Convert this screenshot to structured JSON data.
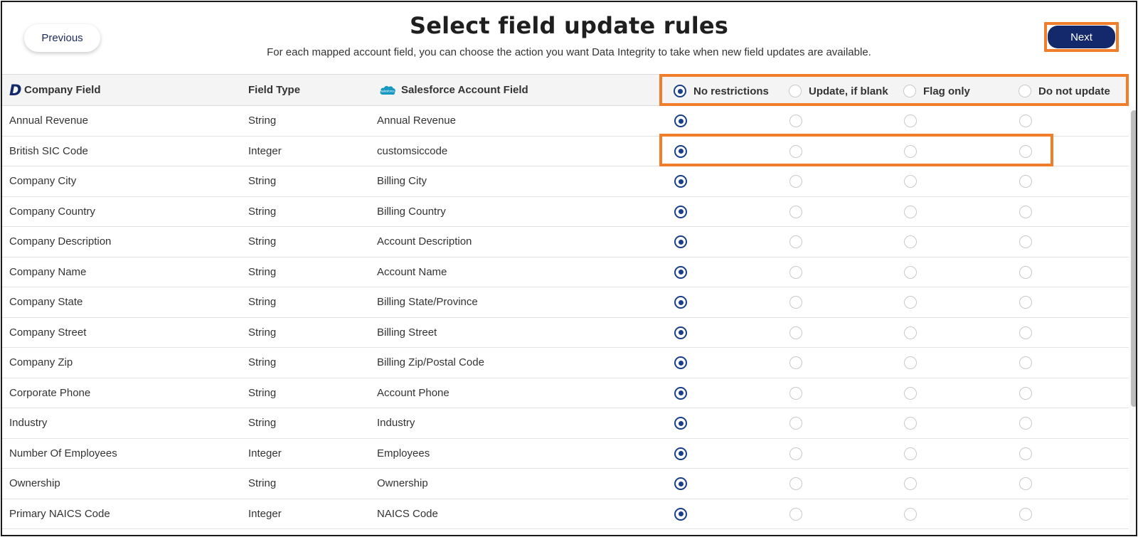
{
  "header": {
    "title": "Select field update rules",
    "subtitle": "For each mapped account field, you can choose the action you want Data Integrity to take when new field updates are available.",
    "previous_label": "Previous",
    "next_label": "Next"
  },
  "table": {
    "columns": {
      "company_field": "Company Field",
      "field_type": "Field Type",
      "salesforce_field": "Salesforce Account Field"
    },
    "logos": {
      "company_logo_text": "D",
      "salesforce_logo_text": "salesforce"
    },
    "options": [
      "No restrictions",
      "Update, if blank",
      "Flag only",
      "Do not update"
    ],
    "selected_option_index": 0,
    "rows": [
      {
        "company": "Annual Revenue",
        "type": "String",
        "salesforce": "Annual Revenue",
        "selected": 0
      },
      {
        "company": "British SIC Code",
        "type": "Integer",
        "salesforce": "customsiccode",
        "selected": 0
      },
      {
        "company": "Company City",
        "type": "String",
        "salesforce": "Billing City",
        "selected": 0
      },
      {
        "company": "Company Country",
        "type": "String",
        "salesforce": "Billing Country",
        "selected": 0
      },
      {
        "company": "Company Description",
        "type": "String",
        "salesforce": "Account Description",
        "selected": 0
      },
      {
        "company": "Company Name",
        "type": "String",
        "salesforce": "Account Name",
        "selected": 0
      },
      {
        "company": "Company State",
        "type": "String",
        "salesforce": "Billing State/Province",
        "selected": 0
      },
      {
        "company": "Company Street",
        "type": "String",
        "salesforce": "Billing Street",
        "selected": 0
      },
      {
        "company": "Company Zip",
        "type": "String",
        "salesforce": "Billing Zip/Postal Code",
        "selected": 0
      },
      {
        "company": "Corporate Phone",
        "type": "String",
        "salesforce": "Account Phone",
        "selected": 0
      },
      {
        "company": "Industry",
        "type": "String",
        "salesforce": "Industry",
        "selected": 0
      },
      {
        "company": "Number Of Employees",
        "type": "Integer",
        "salesforce": "Employees",
        "selected": 0
      },
      {
        "company": "Ownership",
        "type": "String",
        "salesforce": "Ownership",
        "selected": 0
      },
      {
        "company": "Primary NAICS Code",
        "type": "Integer",
        "salesforce": "NAICS Code",
        "selected": 0
      }
    ]
  },
  "colors": {
    "accent_highlight": "#f07d2a",
    "primary_button": "#14296b",
    "radio_selected": "#1a3f8a",
    "salesforce_blue": "#1798c1"
  }
}
